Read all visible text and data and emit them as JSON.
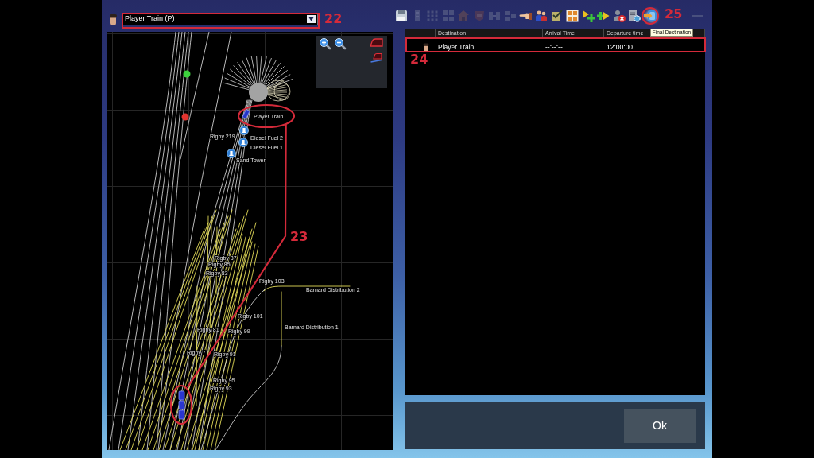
{
  "train_select": {
    "value": "Player Train (P)"
  },
  "map": {
    "labels": [
      "Player Train",
      "Rigby 219",
      "Diesel Fuel 2",
      "Diesel Fuel 1",
      "Sand Tower",
      "Rigby 87",
      "Rigby 85",
      "Rigby 83",
      "Rigby 103",
      "Barnard Distribution 2",
      "Rigby 101",
      "Barnard Distribution 1",
      "Rigby 81",
      "Rigby 99",
      "Rigby 7",
      "Rigby 91",
      "Rigby 95",
      "Rigby 93"
    ],
    "signals": [
      {
        "color": "#3dd13d"
      },
      {
        "color": "#e3342f"
      }
    ]
  },
  "toolbar": [
    {
      "disabled": false
    },
    {
      "disabled": true
    },
    {
      "disabled": true
    },
    {
      "disabled": true
    },
    {
      "disabled": true
    },
    {
      "disabled": true
    },
    {
      "disabled": true
    },
    {
      "disabled": true
    },
    {
      "disabled": false
    },
    {
      "disabled": false
    },
    {
      "disabled": false
    },
    {
      "disabled": false
    },
    {
      "disabled": false
    },
    {
      "disabled": false
    },
    {
      "disabled": false
    },
    {
      "disabled": false
    },
    {
      "disabled": false,
      "tooltip": "Final Destination"
    },
    {
      "disabled": true
    }
  ],
  "table": {
    "columns": [
      "Destination",
      "Arrival Time",
      "Departure time"
    ],
    "rows": [
      {
        "destination": "Player Train",
        "arrival_time": "--:--:--",
        "departure_time": "12:00:00"
      }
    ]
  },
  "buttons": [
    "Ok"
  ],
  "annotations": [
    {
      "label": "22"
    },
    {
      "label": "23"
    },
    {
      "label": "24"
    },
    {
      "label": "25"
    }
  ]
}
